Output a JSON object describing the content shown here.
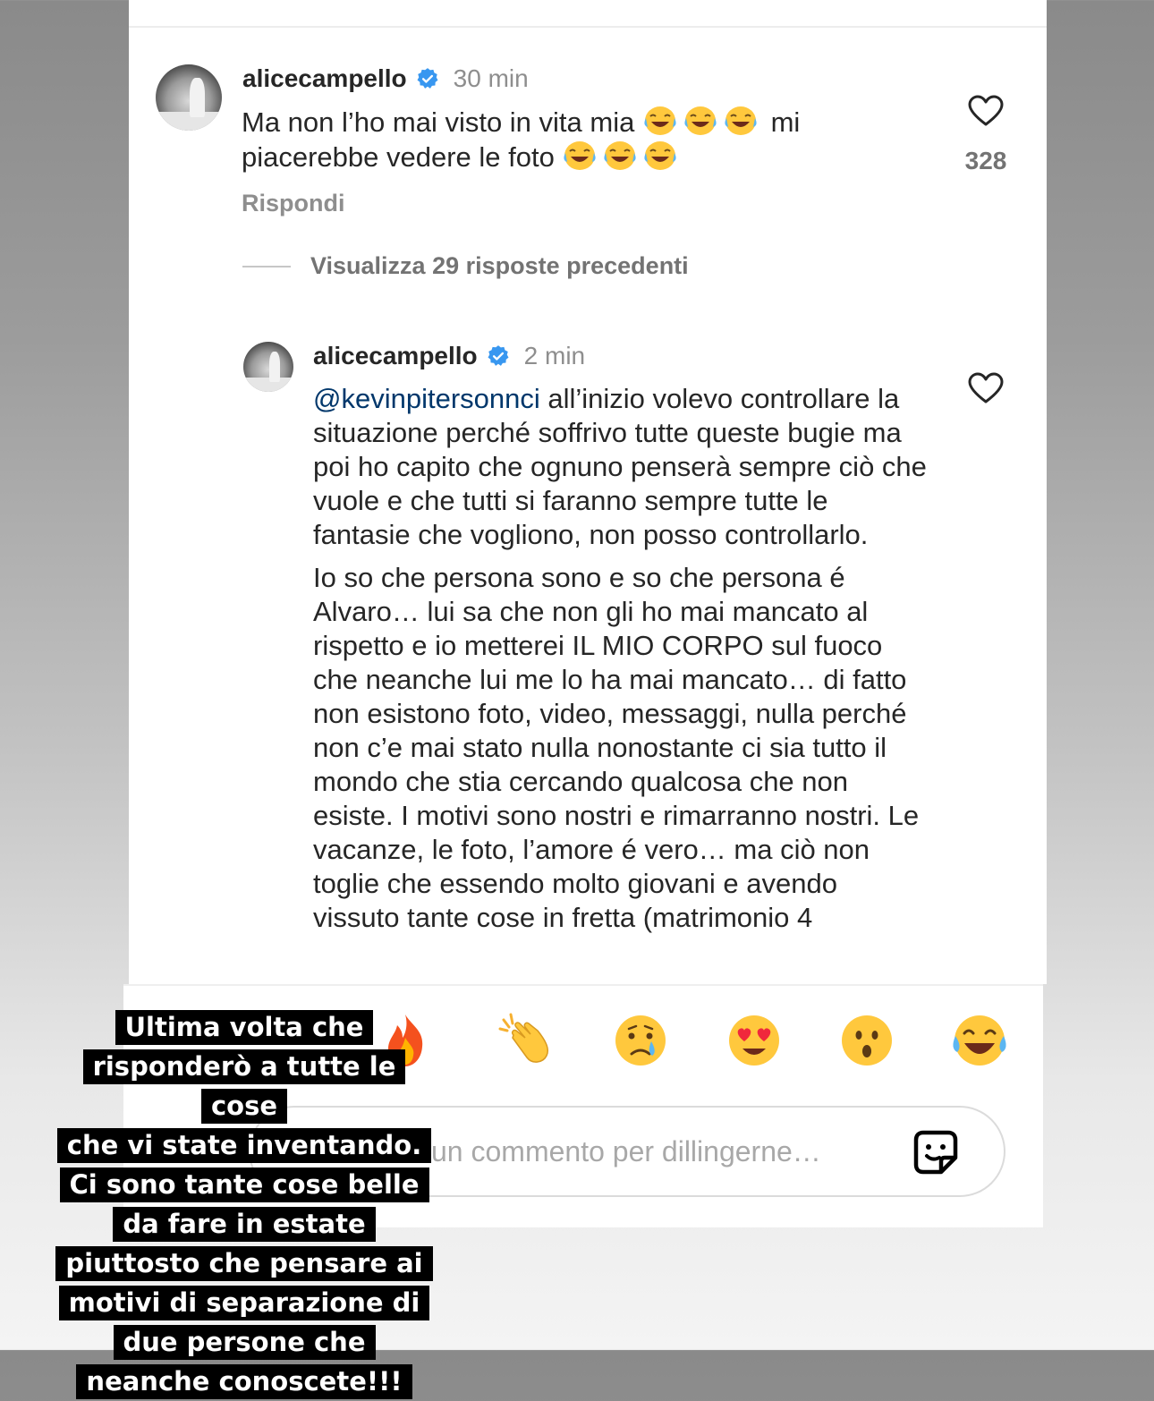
{
  "comment": {
    "username": "alicecampello",
    "time": "30 min",
    "text_before": "Ma non l’ho mai visto in vita mia",
    "text_after": "mi piacerebbe vedere le foto",
    "emoji": "face-with-tears-of-joy",
    "like_count": "328",
    "reply_label": "Rispondi"
  },
  "view_replies": {
    "label": "Visualizza 29 risposte precedenti"
  },
  "reply": {
    "username": "alicecampello",
    "time": "2 min",
    "mention": "@kevinpitersonnci",
    "paragraph1_rest": " all’inizio volevo controllare la situazione perché soffrivo tutte queste bugie ma poi ho capito che ognuno penserà sempre ciò che vuole e che tutti si faranno sempre tutte le fantasie che vogliono, non posso controllarlo.",
    "paragraph2": "Io so che persona sono e so che persona é Alvaro… lui sa che non gli ho mai mancato al rispetto e io metterei IL MIO CORPO sul fuoco che neanche lui me lo ha mai mancato… di fatto non esistono foto, video, messaggi, nulla perché non c’e mai stato nulla nonostante ci sia tutto il mondo che stia cercando qualcosa che non esiste. I motivi sono nostri e rimarranno nostri. Le vacanze, le foto, l’amore é vero… ma ciò non toglie che essendo molto giovani e avendo vissuto tante cose in fretta (matrimonio 4"
  },
  "reactions": [
    "fire",
    "clapping-hands",
    "crying-face",
    "heart-eyes",
    "astonished-face",
    "face-with-tears-of-joy"
  ],
  "comment_input": {
    "placeholder": "un commento per dillingerne…"
  },
  "story_caption": {
    "lines": [
      "Ultima volta che",
      "risponderò a tutte le cose",
      "che vi state inventando.",
      "Ci sono tante cose belle",
      "da fare in estate",
      "piuttosto che pensare ai",
      "motivi di separazione di",
      "due persone che",
      "neanche conoscete!!!"
    ]
  },
  "colors": {
    "verified": "#3897f0",
    "mention": "#00376b",
    "muted": "#8e8e8e"
  }
}
